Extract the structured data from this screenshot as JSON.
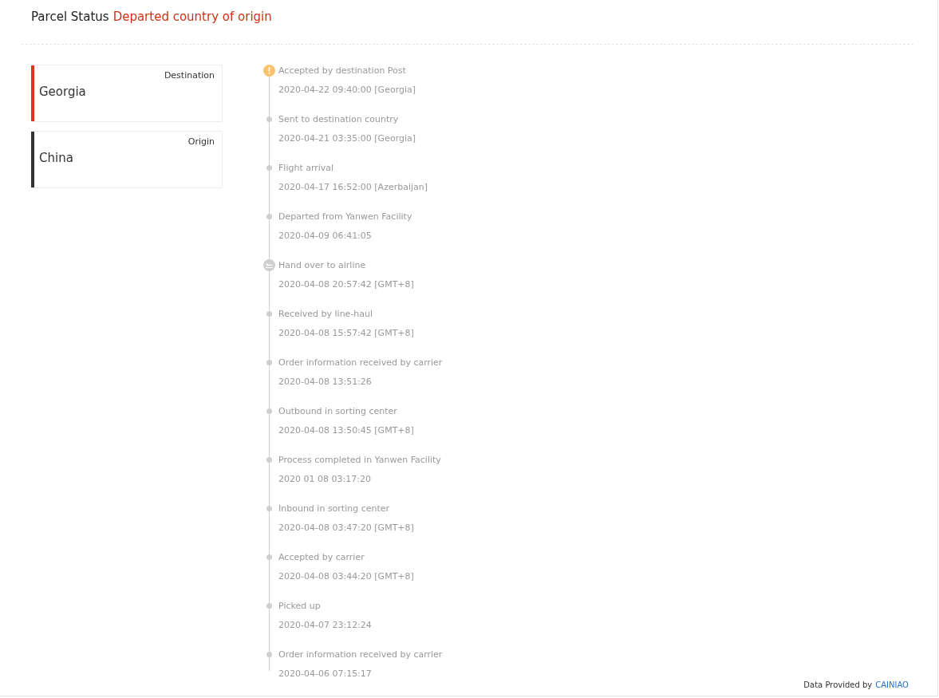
{
  "header": {
    "label": "Parcel Status",
    "status": "Departed country of origin"
  },
  "locations": [
    {
      "label": "Destination",
      "country": "Georgia",
      "color": "#d9391c"
    },
    {
      "label": "Origin",
      "country": "China",
      "color": "#333333"
    }
  ],
  "events": [
    {
      "kind": "alert",
      "title": "Accepted by destination Post",
      "time": "2020-04-22 09:40:00 [Georgia]"
    },
    {
      "kind": "dot",
      "title": "Sent to destination country",
      "time": "2020-04-21 03:35:00 [Georgia]"
    },
    {
      "kind": "dot",
      "title": "Flight arrival",
      "time": "2020-04-17 16:52:00 [Azerbaijan]"
    },
    {
      "kind": "dot",
      "title": "Departed from Yanwen Facility",
      "time": "2020-04-09 06:41:05"
    },
    {
      "kind": "flight",
      "title": "Hand over to airline",
      "time": "2020-04-08 20:57:42 [GMT+8]"
    },
    {
      "kind": "dot",
      "title": "Received by line-haul",
      "time": "2020-04-08 15:57:42 [GMT+8]"
    },
    {
      "kind": "dot",
      "title": "Order information received by carrier",
      "time": "2020-04-08 13:51:26"
    },
    {
      "kind": "dot",
      "title": "Outbound in sorting center",
      "time": "2020-04-08 13:50:45 [GMT+8]"
    },
    {
      "kind": "dot",
      "title": "Process completed in Yanwen Facility",
      "time": "2020 01 08 03:17:20"
    },
    {
      "kind": "dot",
      "title": "Inbound in sorting center",
      "time": "2020-04-08 03:47:20 [GMT+8]"
    },
    {
      "kind": "dot",
      "title": "Accepted by carrier",
      "time": "2020-04-08 03:44:20 [GMT+8]"
    },
    {
      "kind": "dot",
      "title": "Picked up",
      "time": "2020-04-07 23:12:24"
    },
    {
      "kind": "dot",
      "title": "Order information received by carrier",
      "time": "2020-04-06 07:15:17"
    }
  ],
  "footer": {
    "label": "Data Provided by",
    "provider": "CAINIAO"
  }
}
